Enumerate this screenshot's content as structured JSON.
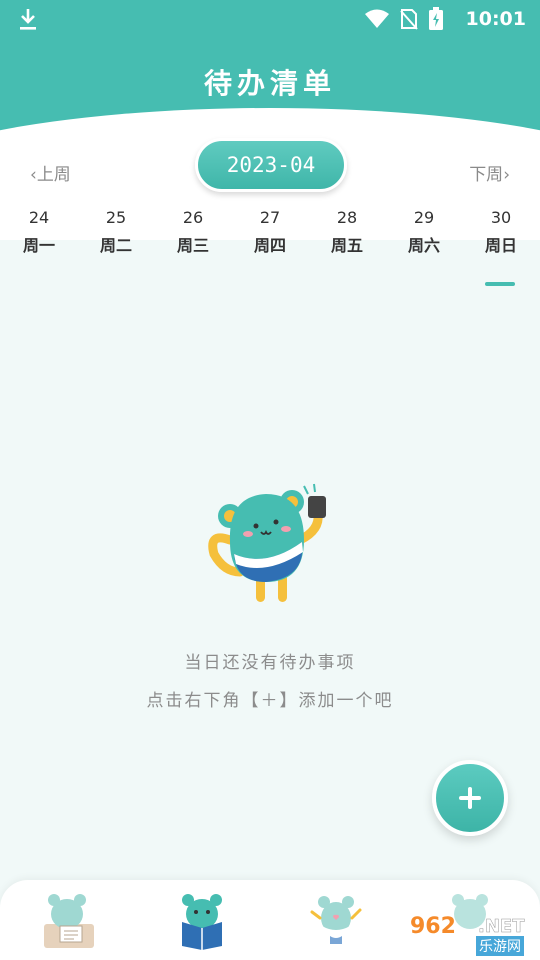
{
  "status_bar": {
    "time": "10:01"
  },
  "header": {
    "title": "待办清单"
  },
  "week_nav": {
    "prev_label": "上周",
    "next_label": "下周",
    "month": "2023-04"
  },
  "days": [
    {
      "num": "24",
      "name": "周一"
    },
    {
      "num": "25",
      "name": "周二"
    },
    {
      "num": "26",
      "name": "周三"
    },
    {
      "num": "27",
      "name": "周四"
    },
    {
      "num": "28",
      "name": "周五"
    },
    {
      "num": "29",
      "name": "周六"
    },
    {
      "num": "30",
      "name": "周日"
    }
  ],
  "selected_day_index": 6,
  "empty_state": {
    "line1": "当日还没有待办事项",
    "line2": "点击右下角【＋】添加一个吧"
  },
  "fab": {
    "icon": "plus-icon"
  },
  "bottom_nav": [
    {
      "icon": "mascot-writing-icon"
    },
    {
      "icon": "mascot-reading-icon"
    },
    {
      "icon": "mascot-cheer-icon"
    },
    {
      "icon": "mascot-profile-icon"
    }
  ],
  "watermark": {
    "brand": "962",
    "suffix": ".NET",
    "sub": "乐游网"
  },
  "colors": {
    "accent": "#46bdb1",
    "background": "#f1f9f8",
    "text_muted": "#8c8c8c"
  }
}
